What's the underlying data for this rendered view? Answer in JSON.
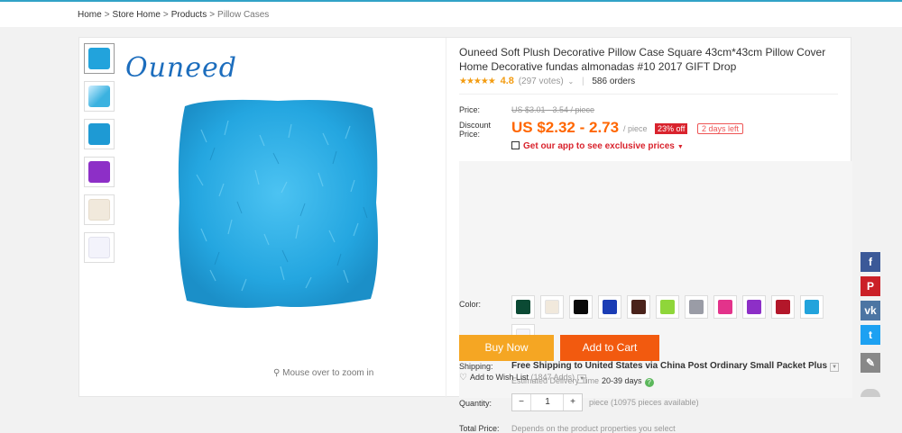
{
  "breadcrumb": [
    {
      "label": "Home"
    },
    {
      "label": "Store Home"
    },
    {
      "label": "Products"
    },
    {
      "label": "Pillow Cases"
    }
  ],
  "product": {
    "title": "Ouneed Soft Plush Decorative Pillow Case Square 43cm*43cm Pillow Cover Home Decorative fundas almonadas #10 2017 GIFT Drop",
    "brand_logo": "Ouneed",
    "zoom_hint": "Mouse over to zoom in",
    "stars": "★★★★★",
    "rating": "4.8",
    "votes": "(297 votes)",
    "orders": "586 orders",
    "price_label": "Price:",
    "original_price": "US $3.01 - 3.54 / piece",
    "discount_label": "Discount Price:",
    "discount_price": "US $2.32 - 2.73",
    "per_piece": "/ piece",
    "discount_badge": "23% off",
    "time_left": "2 days left",
    "app_promo": "Get our app to see exclusive prices",
    "color_label": "Color:",
    "colors": [
      "#0b4a34",
      "#f1e9dc",
      "#0a0a0a",
      "#1b3db5",
      "#4a231b",
      "#8fd63a",
      "#9a9ca6",
      "#e3338b",
      "#8d2fc7",
      "#b3172a",
      "#22a3dc",
      "#f3f3fb"
    ],
    "shipping_label": "Shipping:",
    "shipping_text": "Free Shipping to United States via China Post Ordinary Small Packet Plus",
    "eta_label": "Estimated Delivery Time",
    "eta_days": "20-39 days",
    "quantity_label": "Quantity:",
    "quantity_value": "1",
    "minus": "−",
    "plus": "+",
    "availability": "piece (10975 pieces available)",
    "total_label": "Total Price:",
    "total_text": "Depends on the product properties you select",
    "buy_now": "Buy Now",
    "add_to_cart": "Add to Cart",
    "wish_list": "Add to Wish List",
    "wish_count": "(1847 Adds)"
  },
  "thumbnails": [
    "#22a3dc",
    "#3bb2e0",
    "#1e9ad4",
    "#8d2fc7",
    "#f1e9dc",
    "#f3f3fb"
  ],
  "share": [
    {
      "icon": "facebook-icon",
      "glyph": "f",
      "color": "#3b5998"
    },
    {
      "icon": "pinterest-icon",
      "glyph": "P",
      "color": "#cb2027"
    },
    {
      "icon": "vk-icon",
      "glyph": "vk",
      "color": "#4c75a3"
    },
    {
      "icon": "twitter-icon",
      "glyph": "t",
      "color": "#1da1f2"
    },
    {
      "icon": "edit-icon",
      "glyph": "✎",
      "color": "#888888"
    }
  ]
}
